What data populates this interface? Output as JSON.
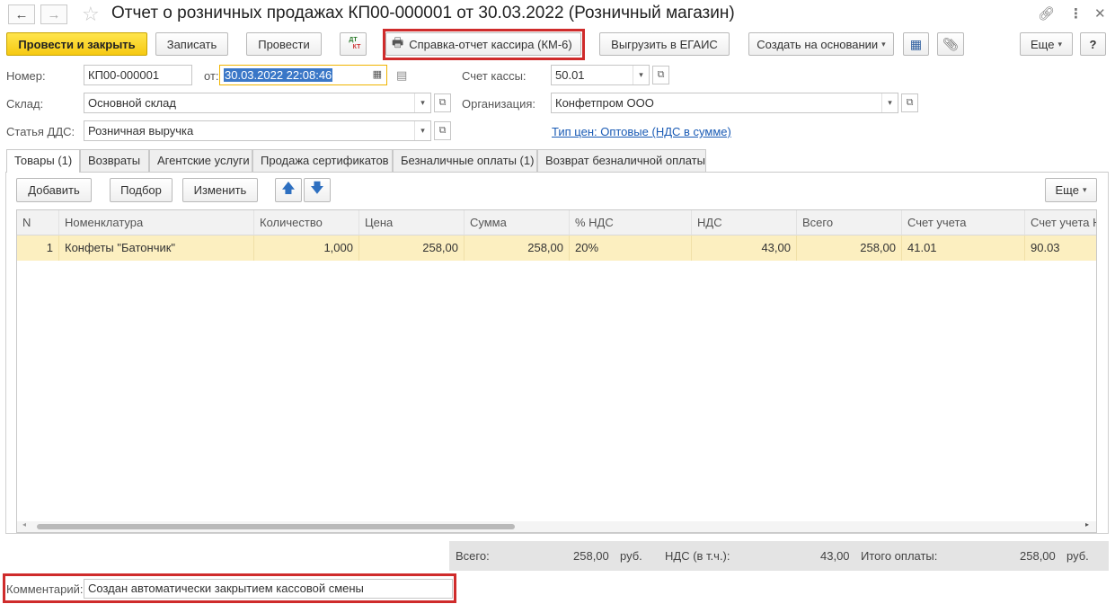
{
  "window": {
    "title": "Отчет о розничных продажах КП00-000001 от 30.03.2022 (Розничный магазин)"
  },
  "toolbar": {
    "post_and_close": "Провести и закрыть",
    "save": "Записать",
    "post": "Провести",
    "dtkt_top": "ДТ",
    "dtkt_bottom": "КТ",
    "cashier_report": "Справка-отчет кассира (КМ-6)",
    "egais": "Выгрузить в ЕГАИС",
    "create_based": "Создать на основании",
    "more": "Еще",
    "help": "?"
  },
  "form": {
    "number_label": "Номер:",
    "number_value": "КП00-000001",
    "date_label": "от:",
    "date_value": "30.03.2022 22:08:46",
    "cash_account_label": "Счет кассы:",
    "cash_account_value": "50.01",
    "warehouse_label": "Склад:",
    "warehouse_value": "Основной склад",
    "org_label": "Организация:",
    "org_value": "Конфетпром ООО",
    "dds_label": "Статья ДДС:",
    "dds_value": "Розничная выручка",
    "price_type_link": "Тип цен: Оптовые (НДС в сумме)"
  },
  "tabs": [
    {
      "label": "Товары (1)"
    },
    {
      "label": "Возвраты"
    },
    {
      "label": "Агентские услуги"
    },
    {
      "label": "Продажа сертификатов"
    },
    {
      "label": "Безналичные оплаты (1)"
    },
    {
      "label": "Возврат безналичной оплаты"
    }
  ],
  "table_toolbar": {
    "add": "Добавить",
    "pick": "Подбор",
    "change": "Изменить",
    "more": "Еще"
  },
  "table": {
    "columns": [
      "N",
      "Номенклатура",
      "Количество",
      "Цена",
      "Сумма",
      "% НДС",
      "НДС",
      "Всего",
      "Счет учета",
      "Счет учета Н"
    ],
    "rows": [
      [
        "1",
        "Конфеты \"Батончик\"",
        "1,000",
        "258,00",
        "258,00",
        "20%",
        "43,00",
        "258,00",
        "41.01",
        "90.03"
      ]
    ]
  },
  "totals": {
    "total_label": "Всего:",
    "total_value": "258,00",
    "currency1": "руб.",
    "vat_label": "НДС (в т.ч.):",
    "vat_value": "43,00",
    "paid_label": "Итого оплаты:",
    "paid_value": "258,00",
    "currency2": "руб."
  },
  "comment": {
    "label": "Комментарий:",
    "value": "Создан автоматически закрытием кассовой смены"
  },
  "colors": {
    "primary_button": "#f6c912",
    "selected_row": "#fcefc0",
    "highlight_frame": "#cf2b2b",
    "link": "#1a5bb5"
  }
}
